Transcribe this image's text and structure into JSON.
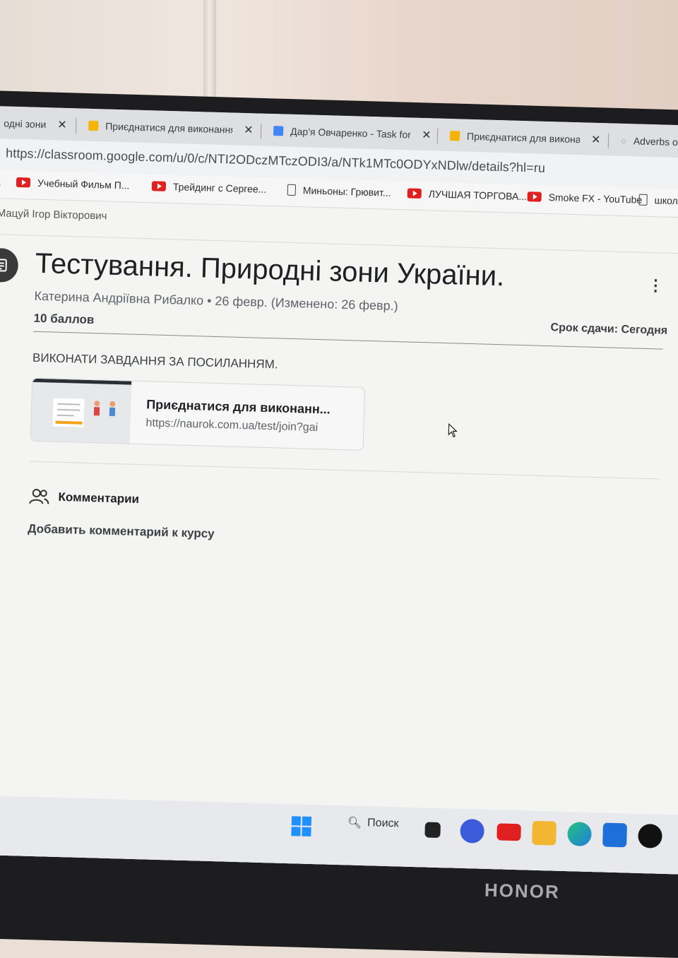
{
  "browser": {
    "tabs": [
      {
        "label": "одні зони",
        "favicon": "bell-icon"
      },
      {
        "label": "Приєднатися для виконання",
        "favicon": "bell-icon"
      },
      {
        "label": "Дар'я Овчаренко - Task for",
        "favicon": "docs-icon"
      },
      {
        "label": "Приєднатися для виконання",
        "favicon": "bell-icon"
      },
      {
        "label": "Adverbs ofMan",
        "favicon": "search-icon"
      }
    ],
    "url": "https://classroom.google.com/u/0/c/NTI2ODczMTczODI3/a/NTk1MTc0ODYxNDlw/details?hl=ru",
    "bookmarks": [
      {
        "label": "а",
        "icon": "none"
      },
      {
        "label": "Учебный Фильм П...",
        "icon": "youtube-icon"
      },
      {
        "label": "Трейдинг с Сергее...",
        "icon": "youtube-icon"
      },
      {
        "label": "Миньоны: Грювит...",
        "icon": "page-icon"
      },
      {
        "label": "ЛУЧШАЯ ТОРГОВА...",
        "icon": "youtube-icon"
      },
      {
        "label": "Smoke FX - YouTube",
        "icon": "youtube-icon"
      },
      {
        "label": "школ",
        "icon": "page-icon"
      }
    ]
  },
  "page": {
    "teacher_breadcrumb": "Мацуй Ігор Вікторович",
    "title": "Тестування.  Природні зони України.",
    "meta": "Катерина Андріївна Рибалко • 26 февр. (Изменено: 26 февр.)",
    "points": "10 баллов",
    "due": "Срок сдачи: Сегодня",
    "instructions": "ВИКОНАТИ ЗАВДАННЯ ЗА ПОСИЛАННЯМ.",
    "attachment": {
      "title": "Приєднатися для виконанн...",
      "url": "https://naurok.com.ua/test/join?gai"
    },
    "comments_label": "Комментарии",
    "add_comment": "Добавить комментарий к курсу"
  },
  "taskbar": {
    "search_label": "Поиск",
    "apps": [
      "windows-start-icon",
      "search-icon",
      "task-view-icon",
      "zoom-icon",
      "youtube-icon",
      "folder-icon",
      "edge-icon",
      "mail-icon",
      "tiktok-icon"
    ]
  },
  "device": {
    "brand": "HONOR"
  },
  "colors": {
    "youtube_red": "#e02020",
    "docs_blue": "#4285f4",
    "bell_yellow": "#f4b400"
  }
}
